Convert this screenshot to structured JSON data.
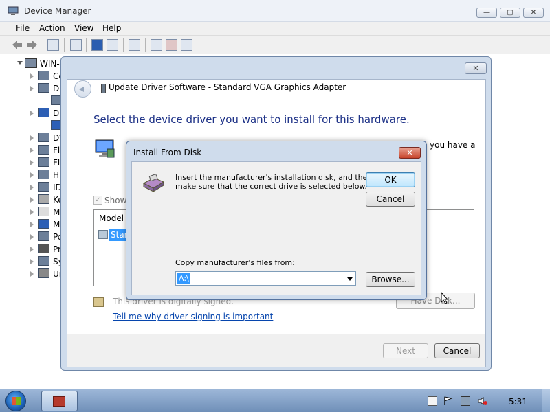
{
  "device_manager": {
    "title": "Device Manager",
    "menu": [
      {
        "label": "File",
        "accel": "F"
      },
      {
        "label": "Action",
        "accel": "A"
      },
      {
        "label": "View",
        "accel": "V"
      },
      {
        "label": "Help",
        "accel": "H"
      }
    ],
    "caption_buttons": {
      "minimize": "—",
      "maximize": "▢",
      "close": "✕"
    },
    "tree": {
      "root": "WIN-",
      "nodes": [
        "Co",
        "Di",
        "",
        "Di",
        "",
        "DV",
        "Fl",
        "Fl",
        "Hu",
        "ID",
        "Ke",
        "M",
        "M",
        "Po",
        "Pr",
        "Sy",
        "Ur"
      ]
    }
  },
  "update_driver": {
    "title": "Update Driver Software - Standard VGA Graphics Adapter",
    "close_glyph": "✕",
    "heading": "Select the device driver you want to install for this hardware.",
    "partial_text": "you have a",
    "show_compatible_label": "Show",
    "list_header": "Model",
    "list_item": "Stand",
    "signed_text": "This driver is digitally signed.",
    "have_disk_label": "Have Disk...",
    "link_text": "Tell me why driver signing is important",
    "next_label": "Next",
    "cancel_label": "Cancel"
  },
  "install_from_disk": {
    "title": "Install From Disk",
    "close_glyph": "✕",
    "message_line1": "Insert the manufacturer's installation disk, and then",
    "message_line2": "make sure that the correct drive is selected below.",
    "ok_label": "OK",
    "cancel_label": "Cancel",
    "copy_label": "Copy manufacturer's files from:",
    "path_value": "A:\\",
    "browse_label": "Browse..."
  },
  "taskbar": {
    "clock": "5:31"
  }
}
